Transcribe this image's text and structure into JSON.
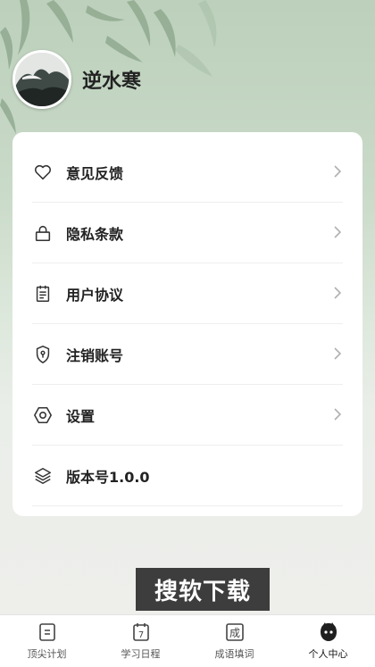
{
  "profile": {
    "username": "逆水寒"
  },
  "menu": [
    {
      "label": "意见反馈",
      "icon": "heart-icon",
      "chevron": true
    },
    {
      "label": "隐私条款",
      "icon": "lock-icon",
      "chevron": true
    },
    {
      "label": "用户协议",
      "icon": "document-icon",
      "chevron": true
    },
    {
      "label": "注销账号",
      "icon": "shield-icon",
      "chevron": true
    },
    {
      "label": "设置",
      "icon": "hexagon-icon",
      "chevron": true
    },
    {
      "label": "版本号1.0.0",
      "icon": "layers-icon",
      "chevron": false
    }
  ],
  "watermark": "搜软下载",
  "tabs": [
    {
      "label": "顶尖计划",
      "icon": "list-icon",
      "active": false
    },
    {
      "label": "学习日程",
      "icon": "calendar-icon",
      "glyph": "7",
      "active": false
    },
    {
      "label": "成语填词",
      "icon": "idiom-icon",
      "glyph": "成",
      "active": false
    },
    {
      "label": "个人中心",
      "icon": "profile-face-icon",
      "active": true
    }
  ],
  "colors": {
    "accent": "#1f1f1f",
    "background_top": "#bcd0bb",
    "card": "#ffffff"
  }
}
